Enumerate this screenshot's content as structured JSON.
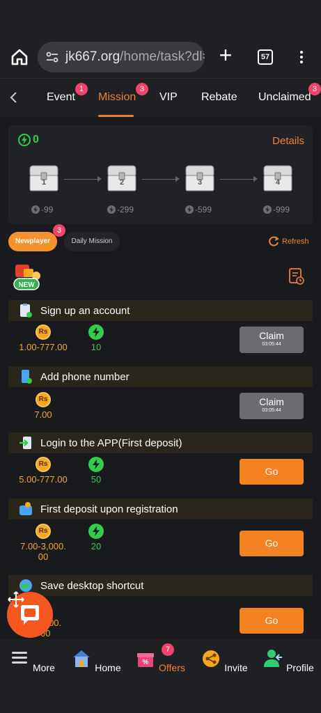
{
  "browser": {
    "url_host": "jk667.org",
    "url_path": "/home/task?dl=",
    "tab_count": "57"
  },
  "topnav": {
    "tabs": [
      {
        "label": "Event",
        "badge": "1"
      },
      {
        "label": "Mission",
        "badge": "3"
      },
      {
        "label": "VIP",
        "badge": ""
      },
      {
        "label": "Rebate",
        "badge": ""
      },
      {
        "label": "Unclaimed",
        "badge": "3"
      }
    ],
    "active": "Mission"
  },
  "progress": {
    "energy": "0",
    "details_label": "Details",
    "chests": [
      {
        "num": "1",
        "req": "-99"
      },
      {
        "num": "2",
        "req": "-299"
      },
      {
        "num": "3",
        "req": "-599"
      },
      {
        "num": "4",
        "req": "-999"
      }
    ]
  },
  "subtabs": {
    "newplayer": "Newplayer",
    "newplayer_badge": "3",
    "daily": "Daily Mission",
    "refresh": "Refresh"
  },
  "tasks": [
    {
      "title": "Sign up an account",
      "rs": "1.00-777.00",
      "bolt": "10",
      "action": "Claim",
      "timer": "03:05:44"
    },
    {
      "title": "Add phone number",
      "rs": "7.00",
      "bolt": "",
      "action": "Claim",
      "timer": "03:05:44"
    },
    {
      "title": "Login to the APP(First deposit)",
      "rs": "5.00-777.00",
      "bolt": "50",
      "action": "Go",
      "timer": ""
    },
    {
      "title": "First deposit upon registration",
      "rs_line1": "7.00-3,000.",
      "rs_line2": "00",
      "bolt": "20",
      "action": "Go",
      "timer": ""
    },
    {
      "title": "Save desktop shortcut",
      "rs_line1": "3,000.",
      "rs_line2": "00",
      "action": "Go"
    }
  ],
  "coin_label": "Rs",
  "bottomnav": {
    "items": [
      "More",
      "Home",
      "Offers",
      "Invite",
      "Profile"
    ],
    "offers_badge": "7",
    "active": "Offers"
  },
  "colors": {
    "accent": "#f08030",
    "energy_green": "#2fcd48",
    "badge_pink": "#f0436c",
    "coin_gold": "#f5a623"
  }
}
